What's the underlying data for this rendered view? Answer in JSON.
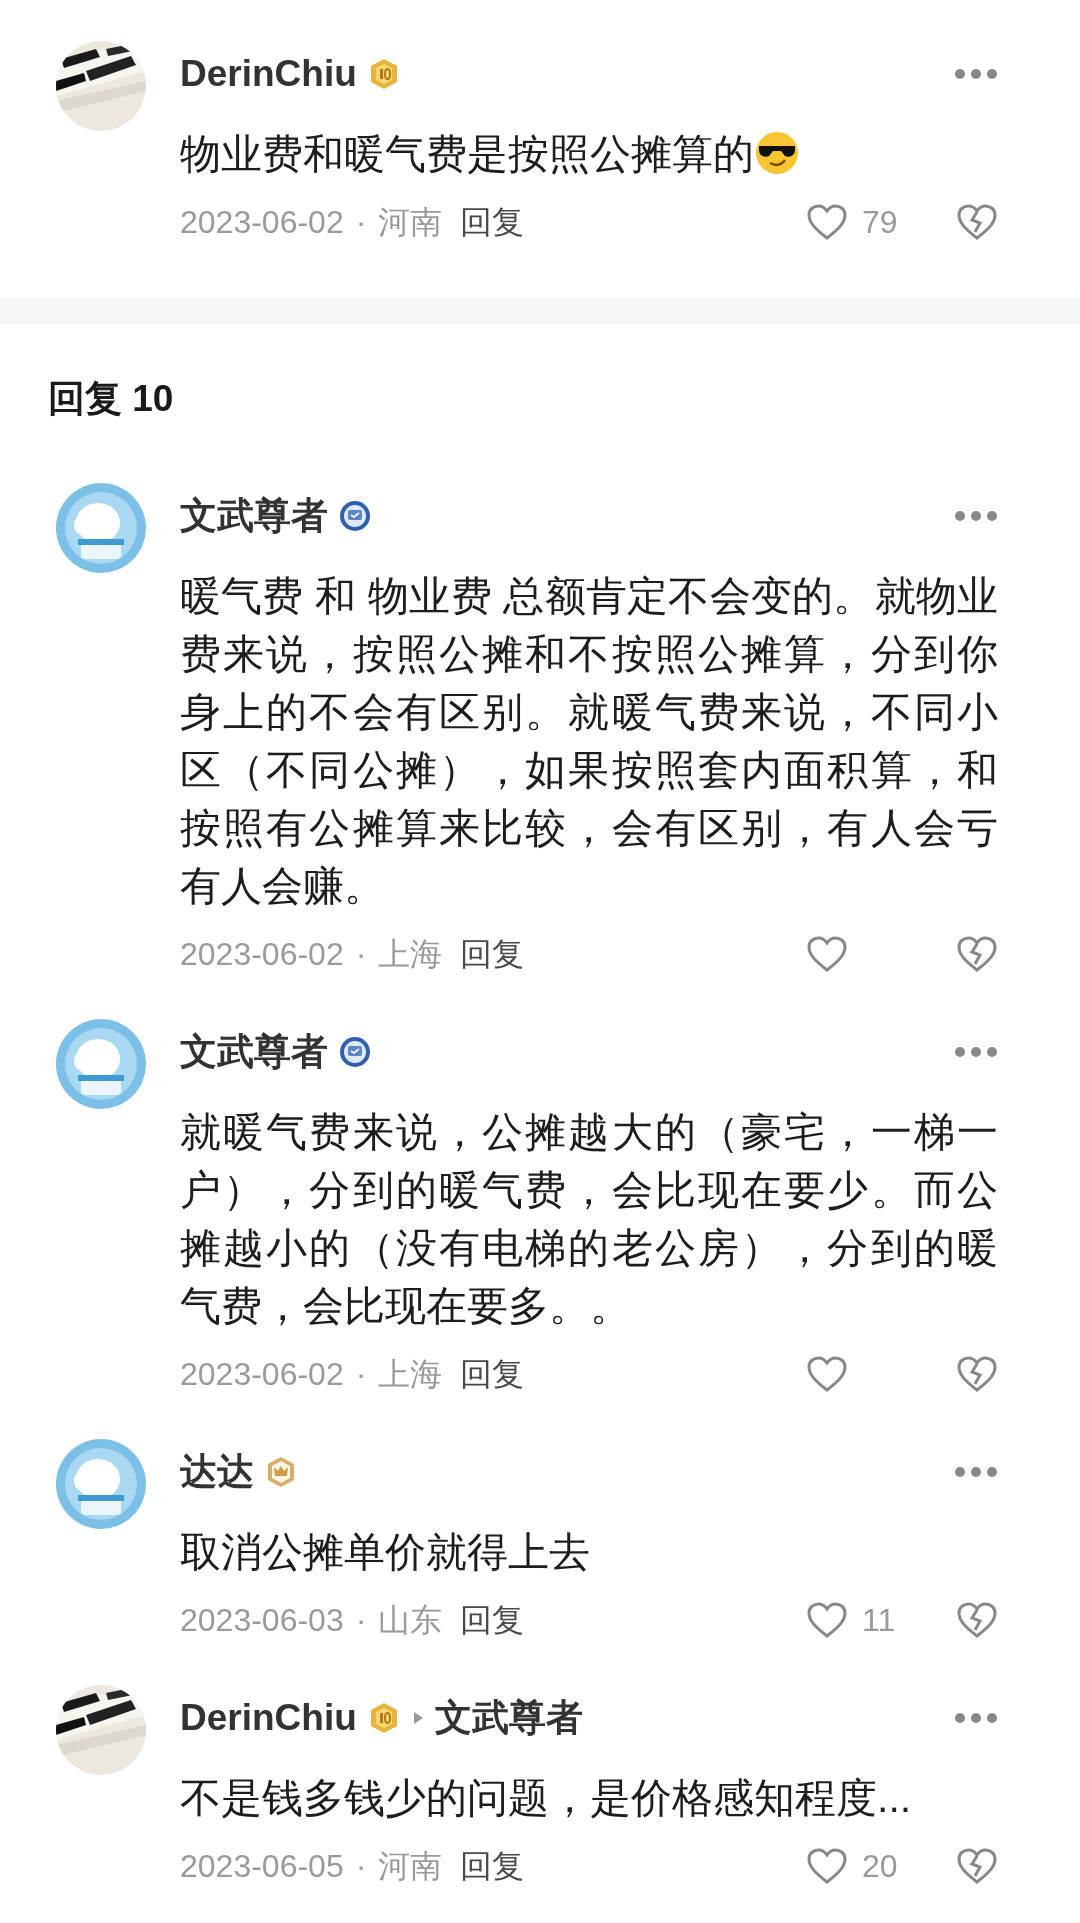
{
  "post": {
    "author": "DerinChiu",
    "badge": {
      "kind": "level"
    },
    "avatar": {
      "kind": "piano"
    },
    "text": "物业费和暖气费是按照公摊算的",
    "emoji": {
      "kind": "sunglasses"
    },
    "date": "2023-06-02",
    "separator": "·",
    "location": "河南",
    "reply_label": "回复",
    "likes": "79"
  },
  "replies_title": "回复 10",
  "replies": [
    {
      "author": "文武尊者",
      "badge": {
        "kind": "verified"
      },
      "avatar": {
        "kind": "bear"
      },
      "text": "暖气费 和 物业费 总额肯定不会变的。就物业费来说，按照公摊和不按照公摊算，分到你身上的不会有区别。就暖气费来说，不同小区（不同公摊），如果按照套内面积算，和按照有公摊算来比较，会有区别，有人会亏有人会赚。",
      "date": "2023-06-02",
      "separator": "·",
      "location": "上海",
      "reply_label": "回复"
    },
    {
      "author": "文武尊者",
      "badge": {
        "kind": "verified"
      },
      "avatar": {
        "kind": "bear"
      },
      "text": "就暖气费来说，公摊越大的（豪宅，一梯一户），分到的暖气费，会比现在要少。而公摊越小的（没有电梯的老公房），分到的暖气费，会比现在要多。。",
      "date": "2023-06-02",
      "separator": "·",
      "location": "上海",
      "reply_label": "回复"
    },
    {
      "author": "达达",
      "badge": {
        "kind": "crown"
      },
      "avatar": {
        "kind": "bear"
      },
      "text": "取消公摊单价就得上去",
      "date": "2023-06-03",
      "separator": "·",
      "location": "山东",
      "reply_label": "回复",
      "likes": "11"
    },
    {
      "author": "DerinChiu",
      "badge": {
        "kind": "level"
      },
      "avatar": {
        "kind": "piano"
      },
      "reply_to": "文武尊者",
      "text": "不是钱多钱少的问题，是价格感知程度...",
      "date": "2023-06-05",
      "separator": "·",
      "location": "河南",
      "reply_label": "回复",
      "likes": "20"
    }
  ]
}
